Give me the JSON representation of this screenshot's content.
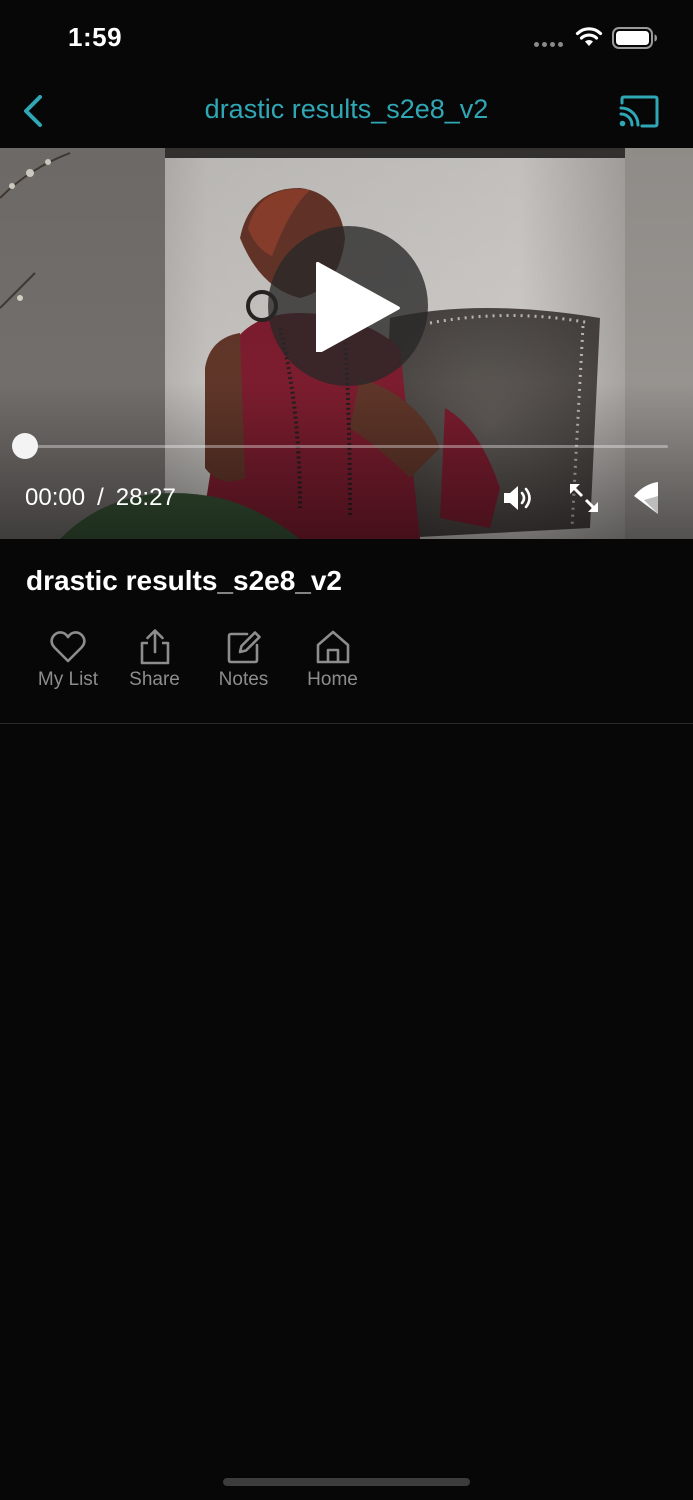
{
  "status_bar": {
    "time": "1:59"
  },
  "nav": {
    "title": "drastic results_s2e8_v2"
  },
  "player": {
    "current_time": "00:00",
    "separator": "/",
    "duration": "28:27",
    "progress_fraction": 0.0
  },
  "details": {
    "title": "drastic results_s2e8_v2",
    "actions": [
      {
        "label": "My List",
        "icon": "heart-icon"
      },
      {
        "label": "Share",
        "icon": "share-icon"
      },
      {
        "label": "Notes",
        "icon": "edit-icon"
      },
      {
        "label": "Home",
        "icon": "home-icon"
      }
    ]
  },
  "colors": {
    "accent": "#2fa7b5",
    "background": "#070707",
    "muted_text": "#8d8d8d"
  }
}
